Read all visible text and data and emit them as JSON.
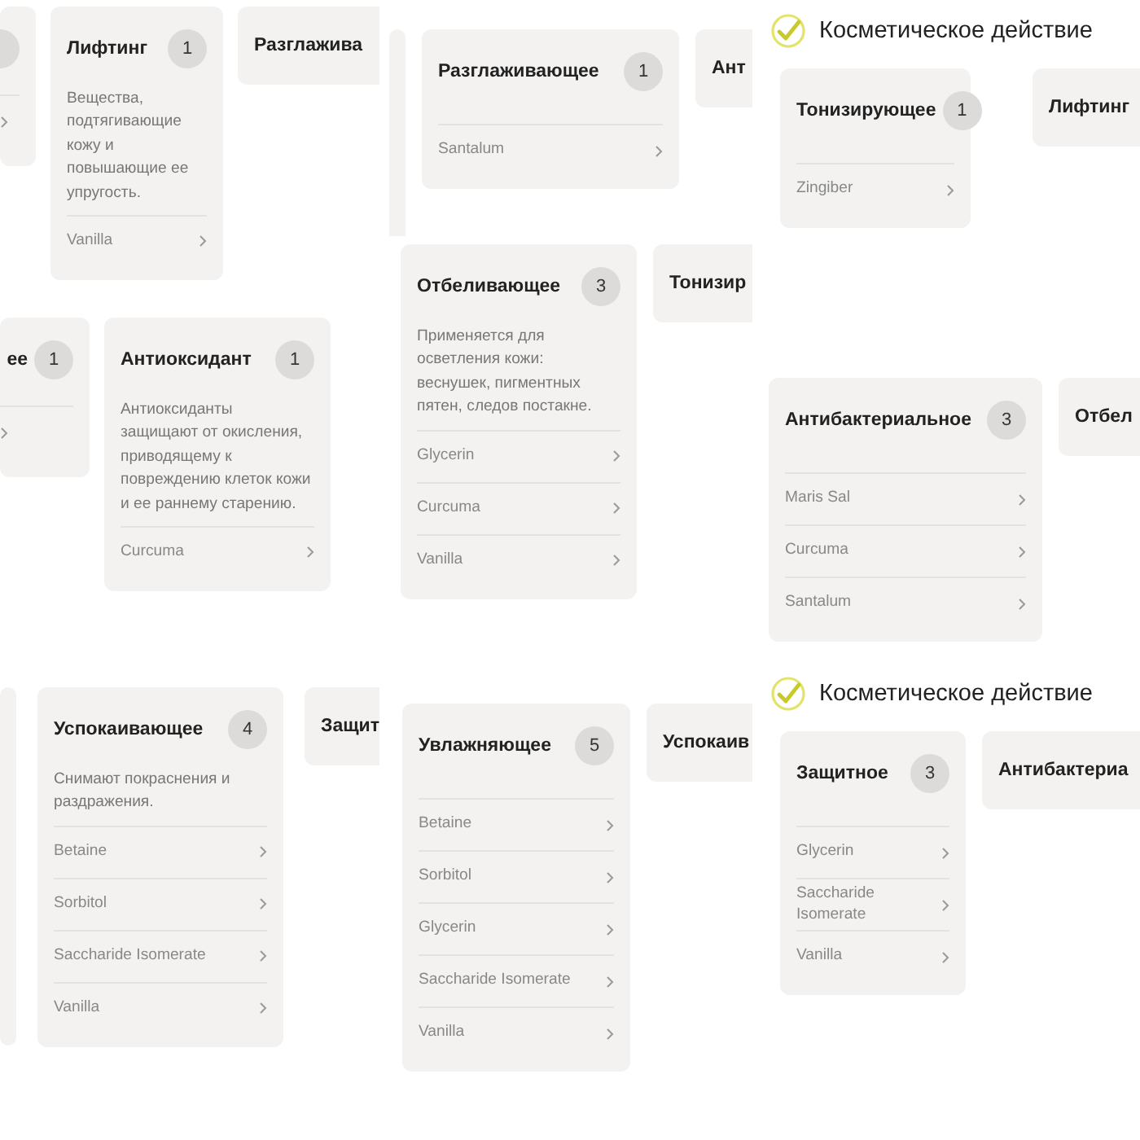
{
  "columns": [
    {
      "tiles": [
        {
          "cards": [
            {
              "kind": "fragment"
            },
            {
              "kind": "full",
              "title": "Лифтинг",
              "count": "1",
              "description": "Вещества, подтягивающие кожу и повышающие ее упругость.",
              "ingredients": [
                "Vanilla"
              ]
            },
            {
              "kind": "partial",
              "title": "Разглажива"
            }
          ]
        },
        {
          "cards": [
            {
              "kind": "fragment",
              "title": "ее",
              "count": "1"
            },
            {
              "kind": "full",
              "title": "Антиоксидант",
              "count": "1",
              "description": "Антиоксиданты защищают от окисления, приводящему к повреждению клеток кожи и ее раннему старению.",
              "ingredients": [
                "Curcuma"
              ]
            }
          ]
        },
        {
          "cards": [
            {
              "kind": "strip"
            },
            {
              "kind": "full",
              "title": "Успокаивающее",
              "count": "4",
              "description": "Снимают покраснения и раздражения.",
              "ingredients": [
                "Betaine",
                "Sorbitol",
                "Saccharide Isomerate",
                "Vanilla"
              ]
            },
            {
              "kind": "partial",
              "title": "Защит"
            }
          ]
        }
      ]
    },
    {
      "tiles": [
        {
          "cards": [
            {
              "kind": "strip"
            },
            {
              "kind": "full",
              "title": "Разглаживающее",
              "count": "1",
              "ingredients": [
                "Santalum"
              ]
            },
            {
              "kind": "partial",
              "title": "Ант"
            }
          ]
        },
        {
          "cards": [
            {
              "kind": "full",
              "title": "Отбеливающее",
              "count": "3",
              "description": "Применяется для осветления кожи: веснушек, пигментных пятен, следов постакне.",
              "ingredients": [
                "Glycerin",
                "Curcuma",
                "Vanilla"
              ]
            },
            {
              "kind": "partial",
              "title": "Тонизир"
            }
          ]
        },
        {
          "cards": [
            {
              "kind": "full",
              "title": "Увлажняющее",
              "count": "5",
              "ingredients": [
                "Betaine",
                "Sorbitol",
                "Glycerin",
                "Saccharide Isomerate",
                "Vanilla"
              ]
            },
            {
              "kind": "partial",
              "title": "Успокаив"
            }
          ]
        }
      ]
    },
    {
      "tiles": [
        {
          "heading": "Косметическое действие",
          "cards": [
            {
              "kind": "full",
              "title": "Тонизирующее",
              "count": "1",
              "ingredients": [
                "Zingiber"
              ]
            },
            {
              "kind": "partial",
              "title": "Лифтинг"
            }
          ]
        },
        {
          "cards": [
            {
              "kind": "full",
              "title": "Антибактериальное",
              "count": "3",
              "ingredients": [
                "Maris Sal",
                "Curcuma",
                "Santalum"
              ]
            },
            {
              "kind": "partial",
              "title": "Отбел"
            }
          ]
        },
        {
          "heading": "Косметическое действие",
          "cards": [
            {
              "kind": "full",
              "title": "Защитное",
              "count": "3",
              "ingredients": [
                "Glycerin",
                "Saccharide Isomerate",
                "Vanilla"
              ]
            },
            {
              "kind": "partial",
              "title": "Антибактериа"
            }
          ]
        }
      ]
    }
  ]
}
